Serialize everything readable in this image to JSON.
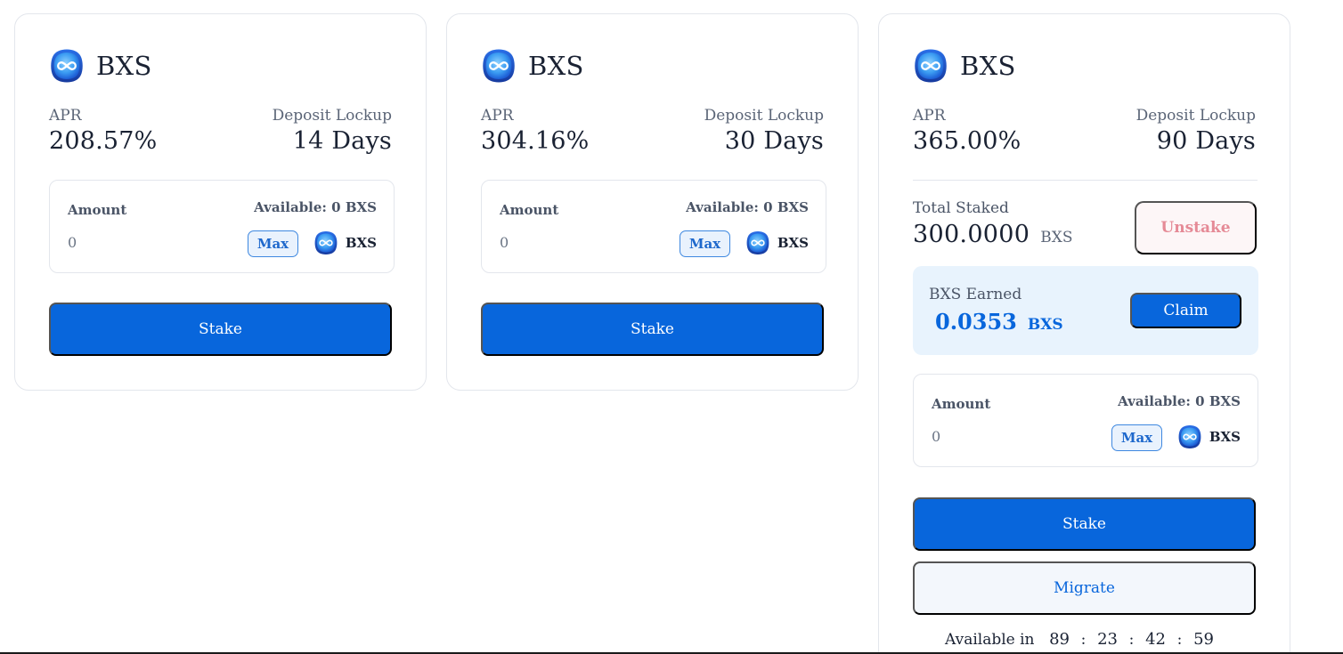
{
  "pools": [
    {
      "token": "BXS",
      "apr_label": "APR",
      "apr": "208.57%",
      "lockup_label": "Deposit Lockup",
      "lockup": "14 Days",
      "amount_label": "Amount",
      "available": "Available: 0 BXS",
      "amount_value": "0",
      "max_label": "Max",
      "token_symbol": "BXS",
      "stake_label": "Stake"
    },
    {
      "token": "BXS",
      "apr_label": "APR",
      "apr": "304.16%",
      "lockup_label": "Deposit Lockup",
      "lockup": "30 Days",
      "amount_label": "Amount",
      "available": "Available: 0 BXS",
      "amount_value": "0",
      "max_label": "Max",
      "token_symbol": "BXS",
      "stake_label": "Stake"
    },
    {
      "token": "BXS",
      "apr_label": "APR",
      "apr": "365.00%",
      "lockup_label": "Deposit Lockup",
      "lockup": "90 Days",
      "total_staked_label": "Total Staked",
      "total_staked": "300.0000",
      "total_staked_unit": "BXS",
      "unstake_label": "Unstake",
      "earned_label": "BXS Earned",
      "earned": "0.0353",
      "earned_unit": "BXS",
      "claim_label": "Claim",
      "amount_label": "Amount",
      "available": "Available: 0 BXS",
      "amount_value": "0",
      "max_label": "Max",
      "token_symbol": "BXS",
      "stake_label": "Stake",
      "migrate_label": "Migrate",
      "countdown_label": "Available in",
      "countdown": [
        "89",
        "23",
        "42",
        "59"
      ],
      "countdown_sep": ":"
    }
  ],
  "icons": {
    "token": "bxs-token-icon"
  },
  "colors": {
    "primary": "#0866dc",
    "unstake_text": "#e58a96",
    "earned_bg": "#e8f3fd",
    "migrate_bg": "#f3f7fc",
    "border": "#e3e6ec"
  }
}
